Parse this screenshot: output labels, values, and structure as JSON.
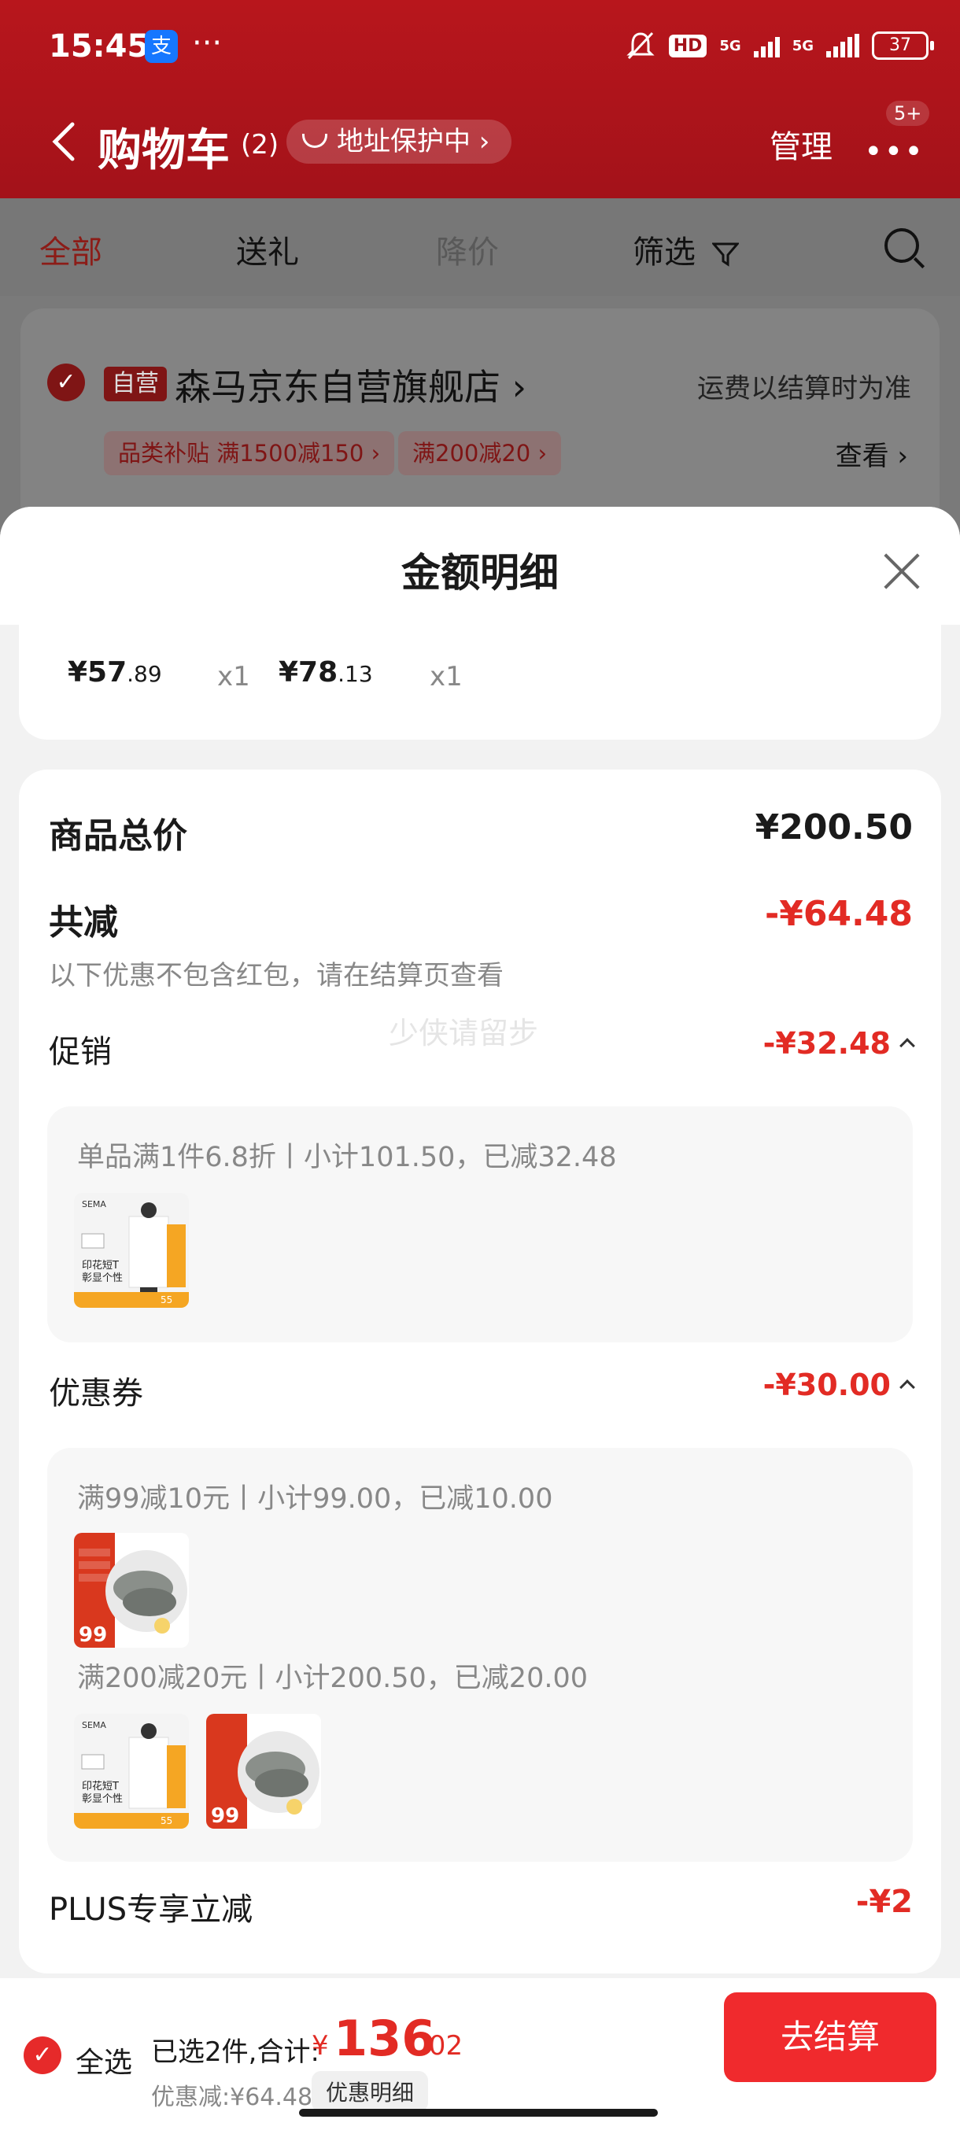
{
  "status_bar": {
    "time": "15:45",
    "dots": "···",
    "hd": "HD",
    "net1": "5G",
    "net2": "5G",
    "battery": "37"
  },
  "nav": {
    "title": "购物车",
    "count": "(2)",
    "address_pill": "地址保护中 ›",
    "manage": "管理",
    "more": "•••",
    "badge": "5+"
  },
  "tabs": [
    {
      "label": "全部"
    },
    {
      "label": "送礼"
    },
    {
      "label": "降价"
    },
    {
      "label": "筛选"
    }
  ],
  "store": {
    "tag": "自营",
    "name": "森马京东自营旗舰店 ›",
    "shipping_note": "运费以结算时为准",
    "promos": [
      "品类补贴 满1500减150 ›",
      "满200减20 ›"
    ],
    "view": "查看 ›"
  },
  "sheet": {
    "title": "金额明细",
    "items": [
      {
        "price_int": "¥57",
        "price_dec": ".89",
        "qty": "x1"
      },
      {
        "price_int": "¥78",
        "price_dec": ".13",
        "qty": "x1"
      }
    ],
    "goods_total_label": "商品总价",
    "goods_total_value": "¥200.50",
    "discount_label": "共减",
    "discount_value": "-¥64.48",
    "discount_note": "以下优惠不包含红包，请在结算页查看",
    "watermark": "少侠请留步",
    "promo_label": "促销",
    "promo_value": "-¥32.48",
    "promo_rule": "单品满1件6.8折丨小计101.50，已减32.48",
    "coupon_label": "优惠券",
    "coupon_value": "-¥30.00",
    "coupon_rule_1": "满99减10元丨小计99.00，已减10.00",
    "coupon_rule_2": "满200减20元丨小计200.50，已减20.00",
    "plus_label": "PLUS专享立减",
    "plus_value": "-¥2",
    "thumb_tshirt": {
      "text1": "印花短T",
      "text2": "彰显个性",
      "price": "55"
    },
    "thumb_shrimp": {
      "price": "99"
    }
  },
  "bottom": {
    "select_all": "全选",
    "selected_info": "已选2件,合计:",
    "currency": "¥",
    "total_int": "136",
    "total_dec": ".02",
    "discount_note": "优惠减:¥64.48",
    "detail_button": "优惠明细",
    "checkout": "去结算"
  }
}
